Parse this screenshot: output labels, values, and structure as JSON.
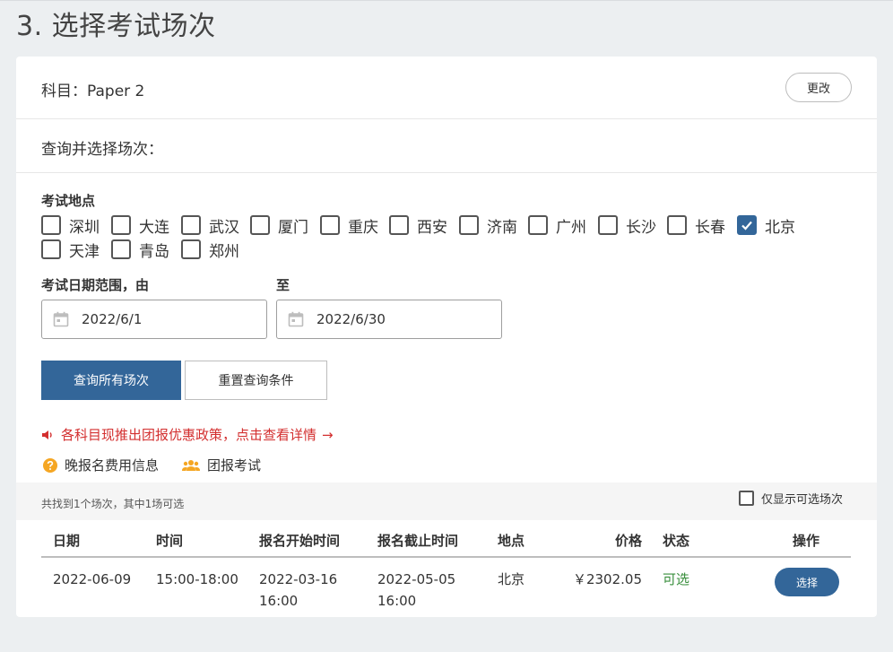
{
  "page": {
    "step_title": "3. 选择考试场次"
  },
  "subject": {
    "label": "科目：",
    "value": "Paper 2",
    "change_label": "更改"
  },
  "query": {
    "label": "查询并选择场次："
  },
  "locations": {
    "label": "考试地点",
    "items": [
      {
        "name": "深圳",
        "checked": false
      },
      {
        "name": "大连",
        "checked": false
      },
      {
        "name": "武汉",
        "checked": false
      },
      {
        "name": "厦门",
        "checked": false
      },
      {
        "name": "重庆",
        "checked": false
      },
      {
        "name": "西安",
        "checked": false
      },
      {
        "name": "济南",
        "checked": false
      },
      {
        "name": "广州",
        "checked": false
      },
      {
        "name": "长沙",
        "checked": false
      },
      {
        "name": "长春",
        "checked": false
      },
      {
        "name": "北京",
        "checked": true
      },
      {
        "name": "天津",
        "checked": false
      },
      {
        "name": "青岛",
        "checked": false
      },
      {
        "name": "郑州",
        "checked": false
      }
    ]
  },
  "dates": {
    "from_label": "考试日期范围，由",
    "to_label": "至",
    "from_value": "2022/6/1",
    "to_value": "2022/6/30"
  },
  "buttons": {
    "search": "查询所有场次",
    "reset": "重置查询条件"
  },
  "promo": {
    "text": "各科目现推出团报优惠政策，点击查看详情",
    "arrow": "→"
  },
  "links": {
    "late_fee": "晚报名费用信息",
    "group_exam": "团报考试"
  },
  "results": {
    "summary": "共找到1个场次，其中1场可选",
    "only_available_label": "仅显示可选场次",
    "only_available_checked": false
  },
  "table": {
    "headers": [
      "日期",
      "时间",
      "报名开始时间",
      "报名截止时间",
      "地点",
      "价格",
      "状态",
      "操作"
    ],
    "rows": [
      {
        "date": "2022-06-09",
        "time": "15:00-18:00",
        "reg_start_date": "2022-03-16",
        "reg_start_time": "16:00",
        "reg_end_date": "2022-05-05",
        "reg_end_time": "16:00",
        "location": "北京",
        "price": "￥2302.05",
        "status": "可选",
        "action": "选择"
      }
    ]
  },
  "colors": {
    "primary": "#336699",
    "promo": "#d32f2f",
    "status_ok": "#388e3c",
    "icon_orange": "#f5a623"
  }
}
